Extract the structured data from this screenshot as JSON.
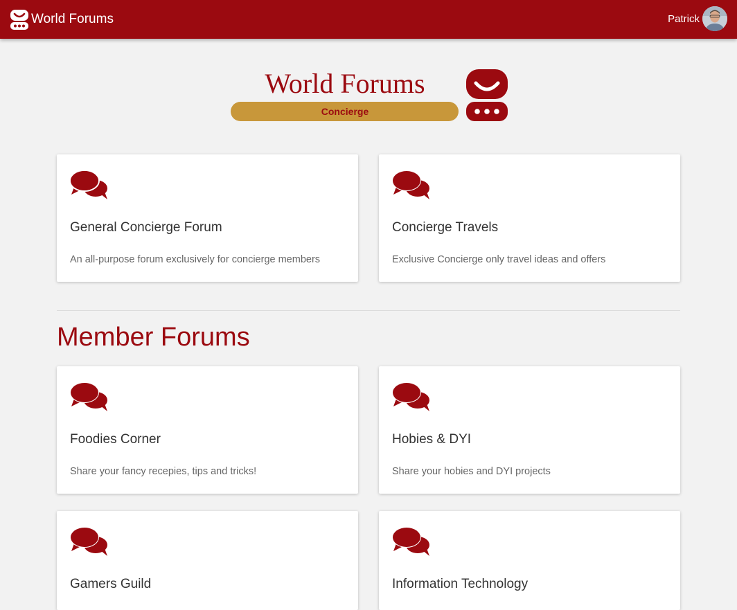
{
  "header": {
    "brand_label": "World Forums",
    "user_name": "Patrick"
  },
  "logo": {
    "title": "World Forums",
    "subtitle": "Concierge"
  },
  "concierge_forums": [
    {
      "title": "General Concierge Forum",
      "description": "An all-purpose forum exclusively for concierge members",
      "icon": "comments-icon"
    },
    {
      "title": "Concierge Travels",
      "description": "Exclusive Concierge only travel ideas and offers",
      "icon": "comments-icon"
    }
  ],
  "member_section": {
    "heading": "Member Forums"
  },
  "member_forums": [
    {
      "title": "Foodies Corner",
      "description": "Share your fancy recepies, tips and tricks!",
      "icon": "comments-icon"
    },
    {
      "title": "Hobies & DYI",
      "description": "Share your hobies and DYI projects",
      "icon": "comments-icon"
    },
    {
      "title": "Gamers Guild",
      "description": "",
      "icon": "comments-icon"
    },
    {
      "title": "Information Technology",
      "description": "",
      "icon": "comments-icon"
    }
  ],
  "colors": {
    "brand": "#9b0a10",
    "logo_bar": "#c8973a",
    "background": "#f2f2f2"
  }
}
